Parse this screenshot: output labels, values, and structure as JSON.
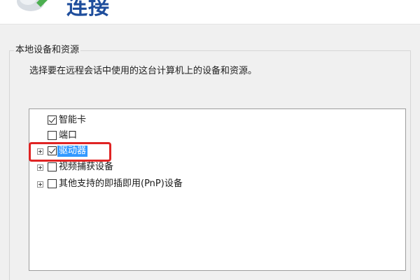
{
  "header": {
    "title": "连接",
    "logo_icon": "remote-desktop-logo-icon"
  },
  "local_resources": {
    "group_label": "本地设备和资源",
    "description": "选择要在远程会话中使用的这台计算机上的设备和资源。"
  },
  "device_tree": {
    "items": [
      {
        "label": "智能卡",
        "checked": true,
        "expandable": false,
        "selected": false
      },
      {
        "label": "端口",
        "checked": false,
        "expandable": false,
        "selected": false
      },
      {
        "label": "驱动器",
        "checked": true,
        "expandable": true,
        "selected": true
      },
      {
        "label": "视频捕获设备",
        "checked": false,
        "expandable": true,
        "selected": false
      },
      {
        "label": "其他支持的即插即用(PnP)设备",
        "checked": false,
        "expandable": true,
        "selected": false
      }
    ]
  },
  "colors": {
    "title": "#1f4e9c",
    "selection": "#3399ff",
    "highlight_box": "#e02424"
  }
}
